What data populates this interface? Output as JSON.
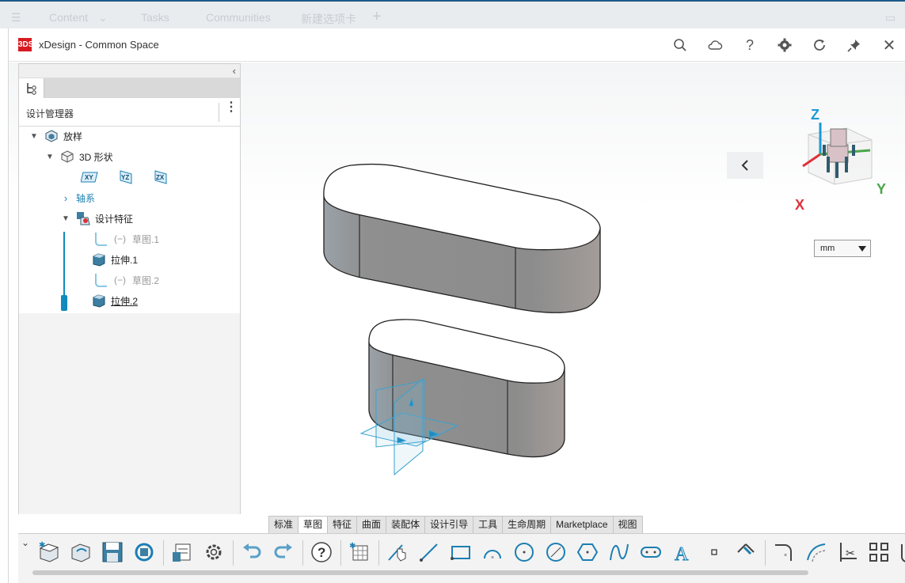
{
  "top_strip": {
    "items": [
      "Content",
      "Tasks",
      "Communities",
      "新建选项卡"
    ]
  },
  "window": {
    "title": "xDesign - Common Space",
    "logo": "3DS"
  },
  "panel": {
    "header_title": "设计管理器",
    "tree": [
      {
        "label": "放样"
      },
      {
        "label": "3D 形状"
      },
      {
        "label": "轴系"
      },
      {
        "label": "设计特征"
      },
      {
        "label": "草图.1",
        "prefix": "(−)"
      },
      {
        "label": "拉伸.1"
      },
      {
        "label": "草图.2",
        "prefix": "(−)"
      },
      {
        "label": "拉伸.2"
      }
    ],
    "planes": [
      "XY",
      "YZ",
      "ZX"
    ]
  },
  "view_cube": {
    "z": "Z",
    "x": "X",
    "y": "Y"
  },
  "unit": "mm",
  "ribbon_tabs": [
    "标准",
    "草图",
    "特征",
    "曲面",
    "装配体",
    "设计引导",
    "工具",
    "生命周期",
    "Marketplace",
    "视图"
  ],
  "active_tab": "草图",
  "colors": {
    "accent": "#0f8bbf",
    "brand": "#d71920",
    "axis_x": "#e0303a",
    "axis_y": "#4aa64a",
    "axis_z": "#1b9ad6"
  }
}
